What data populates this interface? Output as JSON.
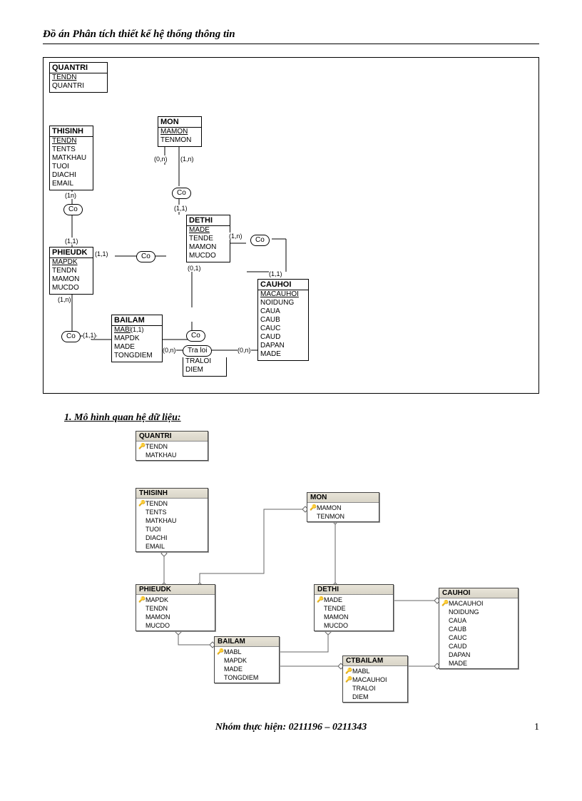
{
  "header_title": "Đồ án Phân tích thiết kế hệ thống thông tin",
  "section1_heading": "1.  Mô hình quan hệ dữ liệu:",
  "footer": "Nhóm thực hiện: 0211196 – 0211343",
  "page_number": "1",
  "er": {
    "entities": {
      "quantri": {
        "title": "QUANTRI",
        "attrs": [
          "TENDN",
          "QUANTRI"
        ],
        "keys": [
          0
        ]
      },
      "thisinh": {
        "title": "THISINH",
        "attrs": [
          "TENDN",
          "TENTS",
          "MATKHAU",
          "TUOI",
          "DIACHI",
          "EMAIL"
        ],
        "keys": [
          0
        ]
      },
      "mon": {
        "title": "MON",
        "attrs": [
          "MAMON",
          "TENMON"
        ],
        "keys": [
          0
        ]
      },
      "phieudk": {
        "title": "PHIEUDK",
        "attrs": [
          "MAPDK",
          "TENDN",
          "MAMON",
          "MUCDO"
        ],
        "keys": [
          0
        ]
      },
      "dethi": {
        "title": "DETHI",
        "attrs": [
          "MADE",
          "TENDE",
          "MAMON",
          "MUCDO"
        ],
        "keys": [
          0
        ]
      },
      "bailam": {
        "title": "BAILAM",
        "attrs": [
          "MABL",
          "MAPDK",
          "MADE",
          "TONGDIEM"
        ],
        "keys": [
          0
        ]
      },
      "cauhoi": {
        "title": "CAUHOI",
        "attrs": [
          "MACAUHOI",
          "NOIDUNG",
          "CAUA",
          "CAUB",
          "CAUC",
          "CAUD",
          "DAPAN",
          "MADE"
        ],
        "keys": [
          0
        ]
      }
    },
    "rel_labels": {
      "co": "Co",
      "traloi": "Tra loi"
    },
    "traloi_attrs": [
      "TRALOI",
      "DIEM"
    ],
    "cards": {
      "c1n_a": "(1n)",
      "c11_a": "(1,1)",
      "c0n_a": "(0,n)",
      "c1n_b": "(1,n)",
      "c11_b": "(1,1)",
      "c11_c": "(1,1)",
      "c1n_c": "(1,n)",
      "c11_d": "(1,1)",
      "c01": "(0,1)",
      "c1n_d": "(1,n)",
      "c11_e": "(1,1)",
      "c11_f": "(1,1)",
      "c0n_b": "(0,n)",
      "c0n_c": "(0,n)"
    }
  },
  "rel_model": {
    "tables": {
      "quantri": {
        "title": "QUANTRI",
        "rows": [
          {
            "k": true,
            "n": "TENDN"
          },
          {
            "k": false,
            "n": "MATKHAU"
          }
        ]
      },
      "thisinh": {
        "title": "THISINH",
        "rows": [
          {
            "k": true,
            "n": "TENDN"
          },
          {
            "k": false,
            "n": "TENTS"
          },
          {
            "k": false,
            "n": "MATKHAU"
          },
          {
            "k": false,
            "n": "TUOI"
          },
          {
            "k": false,
            "n": "DIACHI"
          },
          {
            "k": false,
            "n": "EMAIL"
          }
        ]
      },
      "mon": {
        "title": "MON",
        "rows": [
          {
            "k": true,
            "n": "MAMON"
          },
          {
            "k": false,
            "n": "TENMON"
          }
        ]
      },
      "phieudk": {
        "title": "PHIEUDK",
        "rows": [
          {
            "k": true,
            "n": "MAPDK"
          },
          {
            "k": false,
            "n": "TENDN"
          },
          {
            "k": false,
            "n": "MAMON"
          },
          {
            "k": false,
            "n": "MUCDO"
          }
        ]
      },
      "dethi": {
        "title": "DETHI",
        "rows": [
          {
            "k": true,
            "n": "MADE"
          },
          {
            "k": false,
            "n": "TENDE"
          },
          {
            "k": false,
            "n": "MAMON"
          },
          {
            "k": false,
            "n": "MUCDO"
          }
        ]
      },
      "cauhoi": {
        "title": "CAUHOI",
        "rows": [
          {
            "k": true,
            "n": "MACAUHOI"
          },
          {
            "k": false,
            "n": "NOIDUNG"
          },
          {
            "k": false,
            "n": "CAUA"
          },
          {
            "k": false,
            "n": "CAUB"
          },
          {
            "k": false,
            "n": "CAUC"
          },
          {
            "k": false,
            "n": "CAUD"
          },
          {
            "k": false,
            "n": "DAPAN"
          },
          {
            "k": false,
            "n": "MADE"
          }
        ]
      },
      "bailam": {
        "title": "BAILAM",
        "rows": [
          {
            "k": true,
            "n": "MABL"
          },
          {
            "k": false,
            "n": "MAPDK"
          },
          {
            "k": false,
            "n": "MADE"
          },
          {
            "k": false,
            "n": "TONGDIEM"
          }
        ]
      },
      "ctbailam": {
        "title": "CTBAILAM",
        "rows": [
          {
            "k": true,
            "n": "MABL"
          },
          {
            "k": true,
            "n": "MACAUHOI"
          },
          {
            "k": false,
            "n": "TRALOI"
          },
          {
            "k": false,
            "n": "DIEM"
          }
        ]
      }
    }
  }
}
